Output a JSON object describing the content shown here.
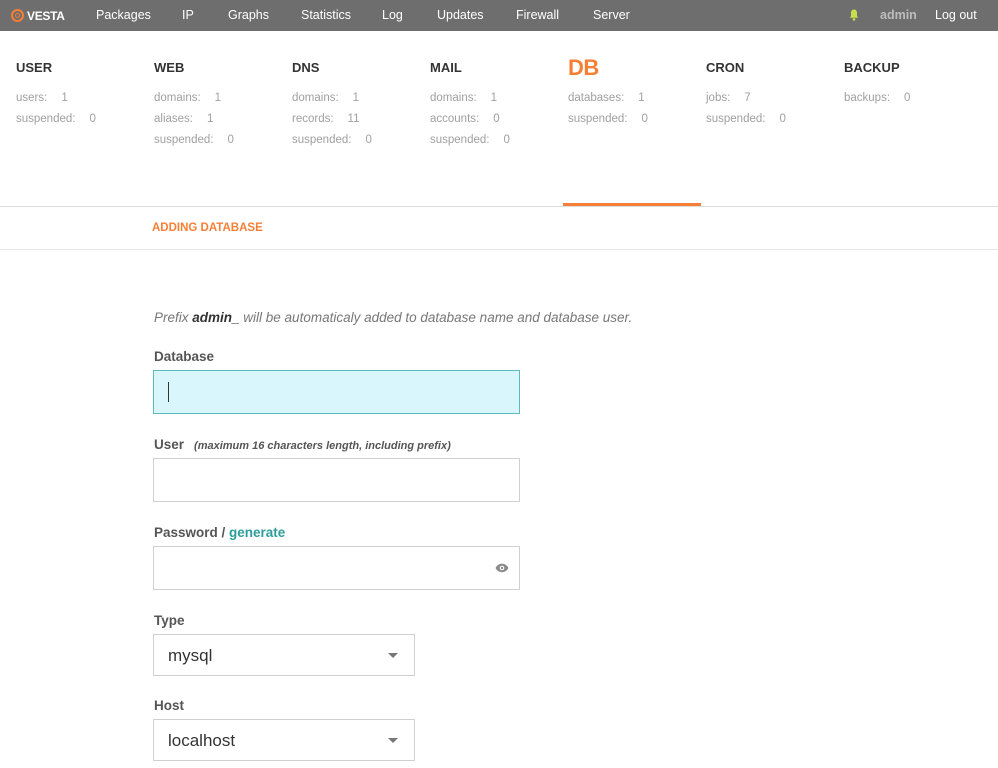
{
  "nav": {
    "logo": "VESTA",
    "items": [
      "Packages",
      "IP",
      "Graphs",
      "Statistics",
      "Log",
      "Updates",
      "Firewall",
      "Server"
    ],
    "user": "admin",
    "logout": "Log out"
  },
  "stats": [
    {
      "title": "USER",
      "lines": [
        {
          "label": "users:",
          "value": "1"
        },
        {
          "label": "suspended:",
          "value": "0"
        }
      ]
    },
    {
      "title": "WEB",
      "lines": [
        {
          "label": "domains:",
          "value": "1"
        },
        {
          "label": "aliases:",
          "value": "1"
        },
        {
          "label": "suspended:",
          "value": "0"
        }
      ]
    },
    {
      "title": "DNS",
      "lines": [
        {
          "label": "domains:",
          "value": "1"
        },
        {
          "label": "records:",
          "value": "11"
        },
        {
          "label": "suspended:",
          "value": "0"
        }
      ]
    },
    {
      "title": "MAIL",
      "lines": [
        {
          "label": "domains:",
          "value": "1"
        },
        {
          "label": "accounts:",
          "value": "0"
        },
        {
          "label": "suspended:",
          "value": "0"
        }
      ]
    },
    {
      "title": "DB",
      "lines": [
        {
          "label": "databases:",
          "value": "1"
        },
        {
          "label": "suspended:",
          "value": "0"
        }
      ]
    },
    {
      "title": "CRON",
      "lines": [
        {
          "label": "jobs:",
          "value": "7"
        },
        {
          "label": "suspended:",
          "value": "0"
        }
      ]
    },
    {
      "title": "BACKUP",
      "lines": [
        {
          "label": "backups:",
          "value": "0"
        }
      ]
    }
  ],
  "subheader": "ADDING DATABASE",
  "form": {
    "prefix_before": "Prefix ",
    "prefix_name": "admin_",
    "prefix_after": " will be automaticaly added to database name and database user.",
    "database_label": "Database",
    "database_value": "",
    "user_label": "User",
    "user_hint": "(maximum 16 characters length, including prefix)",
    "user_value": "",
    "password_label": "Password / ",
    "password_generate": "generate",
    "password_value": "",
    "type_label": "Type",
    "type_value": "mysql",
    "host_label": "Host",
    "host_value": "localhost"
  },
  "colors": {
    "accent": "#f57f35",
    "link": "#2c9e9a",
    "nav_bg": "#6e6e6e",
    "focus_bg": "#d8f6fb"
  }
}
